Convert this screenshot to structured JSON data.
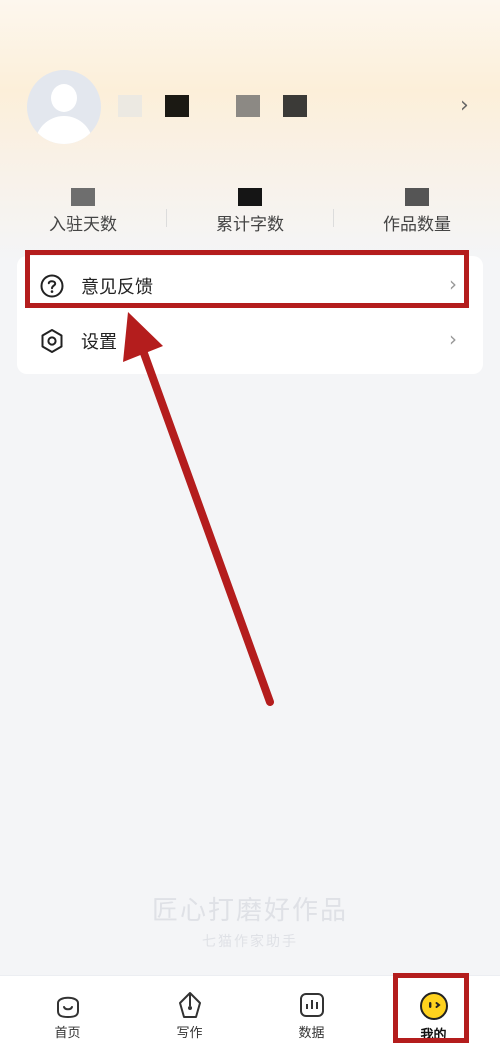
{
  "stats": [
    {
      "label": "入驻天数"
    },
    {
      "label": "累计字数"
    },
    {
      "label": "作品数量"
    }
  ],
  "menu": [
    {
      "label": "意见反馈",
      "icon": "question-circle-icon"
    },
    {
      "label": "设置",
      "icon": "hexagon-settings-icon"
    }
  ],
  "watermark": {
    "main": "匠心打磨好作品",
    "sub": "七猫作家助手"
  },
  "tabs": [
    {
      "label": "首页",
      "icon": "home-face-icon"
    },
    {
      "label": "写作",
      "icon": "pen-nib-icon"
    },
    {
      "label": "数据",
      "icon": "bar-chart-icon"
    },
    {
      "label": "我的",
      "icon": "smiley-face-icon"
    }
  ],
  "colors": {
    "accent": "#b41d1d",
    "tab_active": "#ffd21e"
  }
}
